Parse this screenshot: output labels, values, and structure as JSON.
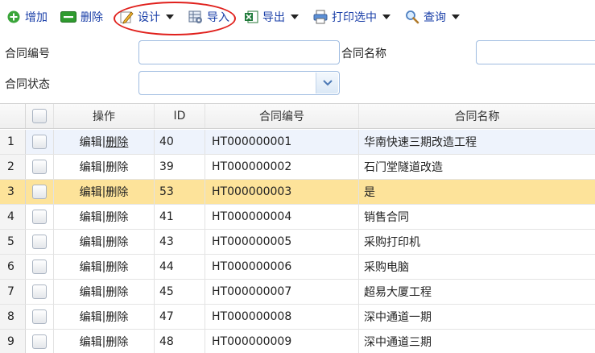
{
  "toolbar": {
    "add_label": "增加",
    "delete_label": "删除",
    "design_label": "设计",
    "import_label": "导入",
    "export_label": "导出",
    "print_label": "打印选中",
    "query_label": "查询",
    "accent_color": "#1a3fa8",
    "annotation_color": "#e0201c"
  },
  "form": {
    "contract_code_label": "合同编号",
    "contract_code_value": "",
    "contract_name_label": "合同名称",
    "contract_name_value": "",
    "contract_status_label": "合同状态",
    "contract_status_value": ""
  },
  "grid": {
    "columns": [
      "操作",
      "ID",
      "合同编号",
      "合同名称"
    ],
    "rows": [
      {
        "num": "1",
        "edit": "编辑",
        "sep": "|",
        "del": "删除",
        "id": "40",
        "code": "HT000000001",
        "name": "华南快速三期改造工程"
      },
      {
        "num": "2",
        "edit": "编辑",
        "sep": "|",
        "del": "删除",
        "id": "39",
        "code": "HT000000002",
        "name": "石门堂隧道改造"
      },
      {
        "num": "3",
        "edit": "编辑",
        "sep": "|",
        "del": "删除",
        "id": "53",
        "code": "HT000000003",
        "name": "是"
      },
      {
        "num": "4",
        "edit": "编辑",
        "sep": "|",
        "del": "删除",
        "id": "41",
        "code": "HT000000004",
        "name": "销售合同"
      },
      {
        "num": "5",
        "edit": "编辑",
        "sep": "|",
        "del": "删除",
        "id": "43",
        "code": "HT000000005",
        "name": "采购打印机"
      },
      {
        "num": "6",
        "edit": "编辑",
        "sep": "|",
        "del": "删除",
        "id": "44",
        "code": "HT000000006",
        "name": "采购电脑"
      },
      {
        "num": "7",
        "edit": "编辑",
        "sep": "|",
        "del": "删除",
        "id": "45",
        "code": "HT000000007",
        "name": "超易大厦工程"
      },
      {
        "num": "8",
        "edit": "编辑",
        "sep": "|",
        "del": "删除",
        "id": "47",
        "code": "HT000000008",
        "name": "深中通道一期"
      },
      {
        "num": "9",
        "edit": "编辑",
        "sep": "|",
        "del": "删除",
        "id": "48",
        "code": "HT000000009",
        "name": "深中通道三期"
      }
    ],
    "selected_color": "#fde39a",
    "hover_color": "#eef3fc"
  }
}
